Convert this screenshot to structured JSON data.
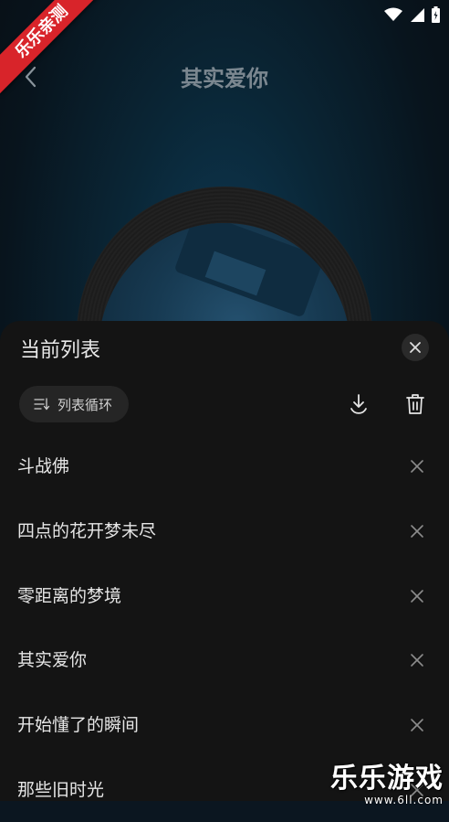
{
  "player": {
    "title": "其实爱你"
  },
  "ribbon": "乐乐亲测",
  "sheet": {
    "title": "当前列表",
    "play_mode": "列表循环"
  },
  "songs": [
    {
      "name": "斗战佛"
    },
    {
      "name": "四点的花开梦未尽"
    },
    {
      "name": "零距离的梦境"
    },
    {
      "name": "其实爱你"
    },
    {
      "name": "开始懂了的瞬间"
    },
    {
      "name": "那些旧时光"
    }
  ],
  "watermark": {
    "brand": "乐乐游戏",
    "url": "www.6ll.com"
  },
  "icons": {
    "back": "chevron-left-icon",
    "close": "close-icon",
    "play_mode": "list-loop-icon",
    "download": "download-icon",
    "delete": "trash-icon",
    "remove": "close-icon",
    "wifi": "wifi-icon",
    "signal": "signal-icon",
    "battery": "battery-icon"
  }
}
